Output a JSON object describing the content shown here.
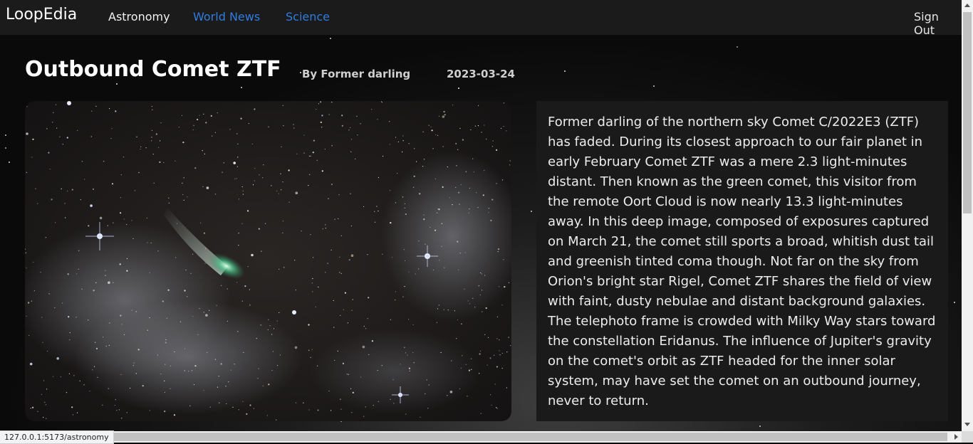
{
  "nav": {
    "brand": "LoopEdia",
    "links": [
      {
        "label": "Astronomy",
        "active": true
      },
      {
        "label": "World News",
        "active": false
      },
      {
        "label": "Science",
        "active": false
      }
    ],
    "sign_out": "Sign Out"
  },
  "article": {
    "title": "Outbound Comet ZTF",
    "author": "By Former darling",
    "date": "2023-03-24",
    "image_alt": "Comet ZTF",
    "body": "Former darling of the northern sky Comet C/2022E3 (ZTF) has faded. During its closest approach to our fair planet in early February Comet ZTF was a mere 2.3 light-minutes distant. Then known as the green comet, this visitor from the remote Oort Cloud is now nearly 13.3 light-minutes away. In this deep image, composed of exposures captured on March 21, the comet still sports a broad, whitish dust tail and greenish tinted coma though. Not far on the sky from Orion's bright star Rigel, Comet ZTF shares the field of view with faint, dusty nebulae and distant background galaxies. The telephoto frame is crowded with Milky Way stars toward the constellation Eridanus. The influence of Jupiter's gravity on the comet's orbit as ZTF headed for the inner solar system, may have set the comet on an outbound journey, never to return."
  },
  "status_bar": {
    "url": "127.0.0.1:5173/astronomy"
  },
  "colors": {
    "nav_bg": "#1b1b1b",
    "link": "#2f7de0",
    "panel_bg": "#1a1a1a"
  }
}
